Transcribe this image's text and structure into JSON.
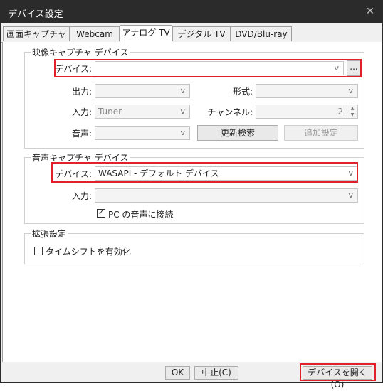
{
  "window": {
    "title": "デバイス設定"
  },
  "tabs": [
    {
      "label": "画面キャプチャ"
    },
    {
      "label": "Webcam"
    },
    {
      "label": "アナログ TV"
    },
    {
      "label": "デジタル TV"
    },
    {
      "label": "DVD/Blu-ray"
    }
  ],
  "video_group": {
    "title": "映像キャプチャ デバイス",
    "device_label": "デバイス:",
    "device_value": "",
    "more_button": "...",
    "output_label": "出力:",
    "format_label": "形式:",
    "input_label": "入力:",
    "input_value": "Tuner",
    "channel_label": "チャンネル:",
    "channel_value": "2",
    "audio_label": "音声:",
    "rescan_button": "更新検索",
    "extra_button": "追加設定"
  },
  "audio_group": {
    "title": "音声キャプチャ デバイス",
    "device_label": "デバイス:",
    "device_value": "WASAPI - デフォルト デバイス",
    "input_label": "入力:",
    "pc_audio_label": "PC の音声に接続",
    "pc_audio_checked": true
  },
  "ext_group": {
    "title": "拡張設定",
    "timeshift_label": "タイムシフトを有効化",
    "timeshift_checked": false
  },
  "footer": {
    "ok": "OK",
    "cancel": "中止(C)",
    "open_device": "デバイスを開く(O)"
  },
  "colors": {
    "highlight": "#e0202a",
    "titlebar": "#2b2b2b"
  },
  "icons": {
    "close": "close-icon",
    "dropdown": "chevron-down-icon",
    "check": "checkmark-icon"
  }
}
